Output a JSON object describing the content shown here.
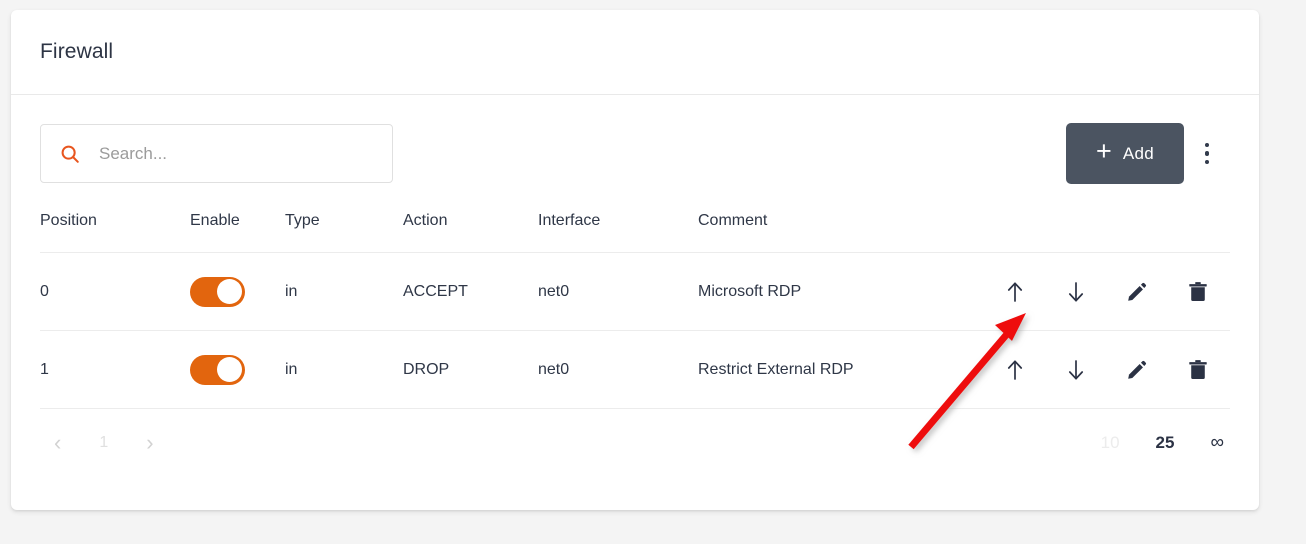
{
  "card": {
    "title": "Firewall"
  },
  "toolbar": {
    "search_placeholder": "Search...",
    "search_value": "",
    "search_icon": "search-icon",
    "add_label": "Add",
    "add_plus": "+",
    "kebab_icon": "more-vertical-icon"
  },
  "table": {
    "headers": [
      "Position",
      "Enable",
      "Type",
      "Action",
      "Interface",
      "Comment"
    ],
    "rows": [
      {
        "position": "0",
        "enabled": true,
        "type": "in",
        "action": "ACCEPT",
        "interface": "net0",
        "comment": "Microsoft RDP"
      },
      {
        "position": "1",
        "enabled": true,
        "type": "in",
        "action": "DROP",
        "interface": "net0",
        "comment": "Restrict External RDP"
      }
    ],
    "row_action_icons": [
      "arrow-up-icon",
      "arrow-down-icon",
      "edit-pencil-icon",
      "delete-trash-icon"
    ]
  },
  "pagination": {
    "prev_label": "‹",
    "page_label": "1",
    "next_label": "›",
    "page_sizes": [
      {
        "label": "10",
        "selected": false
      },
      {
        "label": "25",
        "selected": true
      },
      {
        "label": "∞",
        "selected": false
      }
    ]
  },
  "annotation": {
    "type": "arrow",
    "color": "#ee1111",
    "points_to": "row-0-move-up-icon"
  },
  "colors": {
    "accent_orange": "#e2650e",
    "search_icon_orange": "#e8551e",
    "add_button_bg": "#4b5461",
    "text_dark": "#2f3747",
    "page_bg": "#f4f4f4",
    "card_bg": "#ffffff",
    "annotation_red": "#ee1111"
  }
}
